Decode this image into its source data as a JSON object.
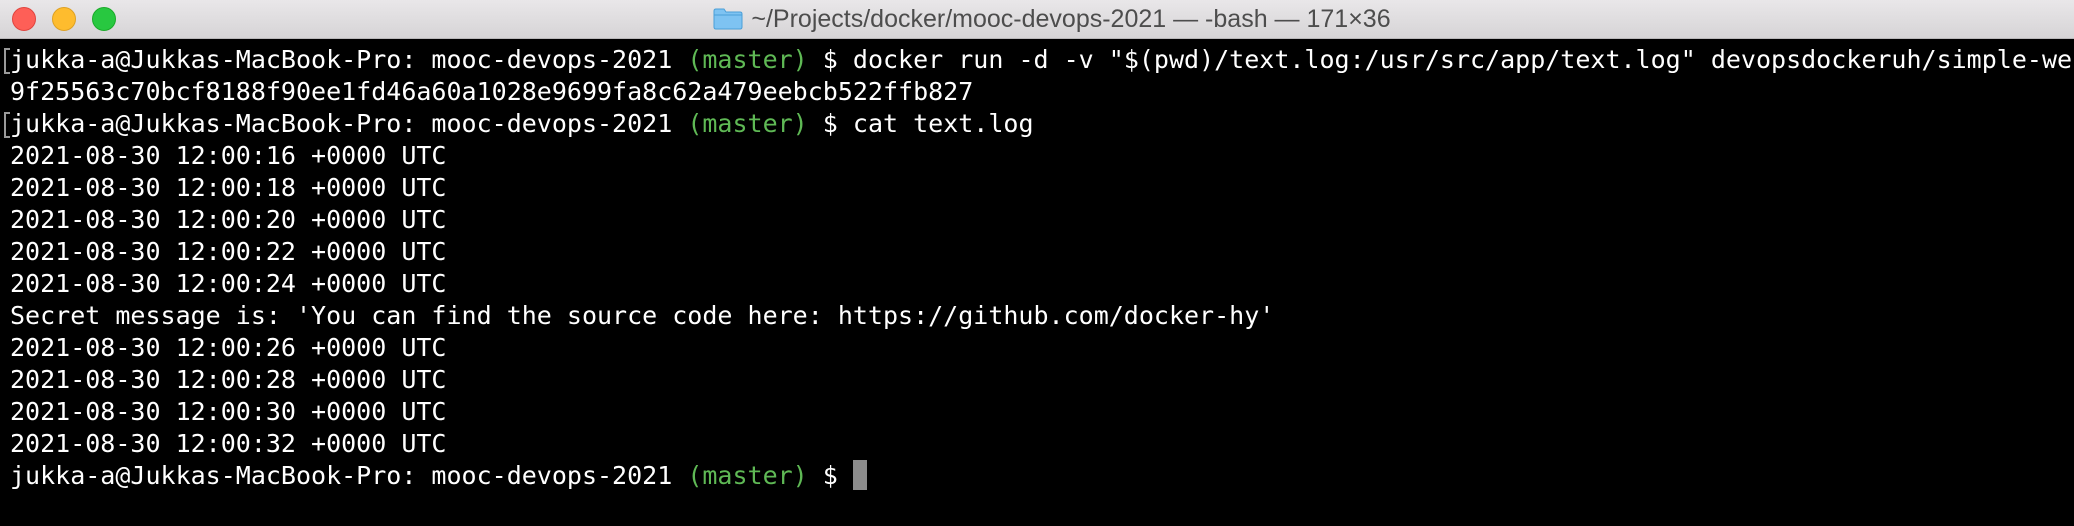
{
  "window": {
    "title": "~/Projects/docker/mooc-devops-2021 — -bash — 171×36"
  },
  "terminal": {
    "prompt_user": "jukka-a@Jukkas-MacBook-Pro: mooc-devops-2021 ",
    "prompt_branch": "(master)",
    "prompt_symbol": " $ ",
    "cmd1": "docker run -d -v \"$(pwd)/text.log:/usr/src/app/text.log\" devopsdockeruh/simple-web-service",
    "output1": "9f25563c70bcf8188f90ee1fd46a60a1028e9699fa8c62a479eebcb522ffb827",
    "cmd2": "cat text.log",
    "log_lines": [
      "2021-08-30 12:00:16 +0000 UTC",
      "2021-08-30 12:00:18 +0000 UTC",
      "2021-08-30 12:00:20 +0000 UTC",
      "2021-08-30 12:00:22 +0000 UTC",
      "2021-08-30 12:00:24 +0000 UTC",
      "Secret message is: 'You can find the source code here: https://github.com/docker-hy'",
      "2021-08-30 12:00:26 +0000 UTC",
      "2021-08-30 12:00:28 +0000 UTC",
      "2021-08-30 12:00:30 +0000 UTC",
      "2021-08-30 12:00:32 +0000 UTC"
    ]
  },
  "colors": {
    "background": "#000000",
    "text": "#ffffff",
    "branch": "#5fb955",
    "cursor": "#8c8c8c"
  },
  "icons": {
    "folder": "folder-icon"
  }
}
